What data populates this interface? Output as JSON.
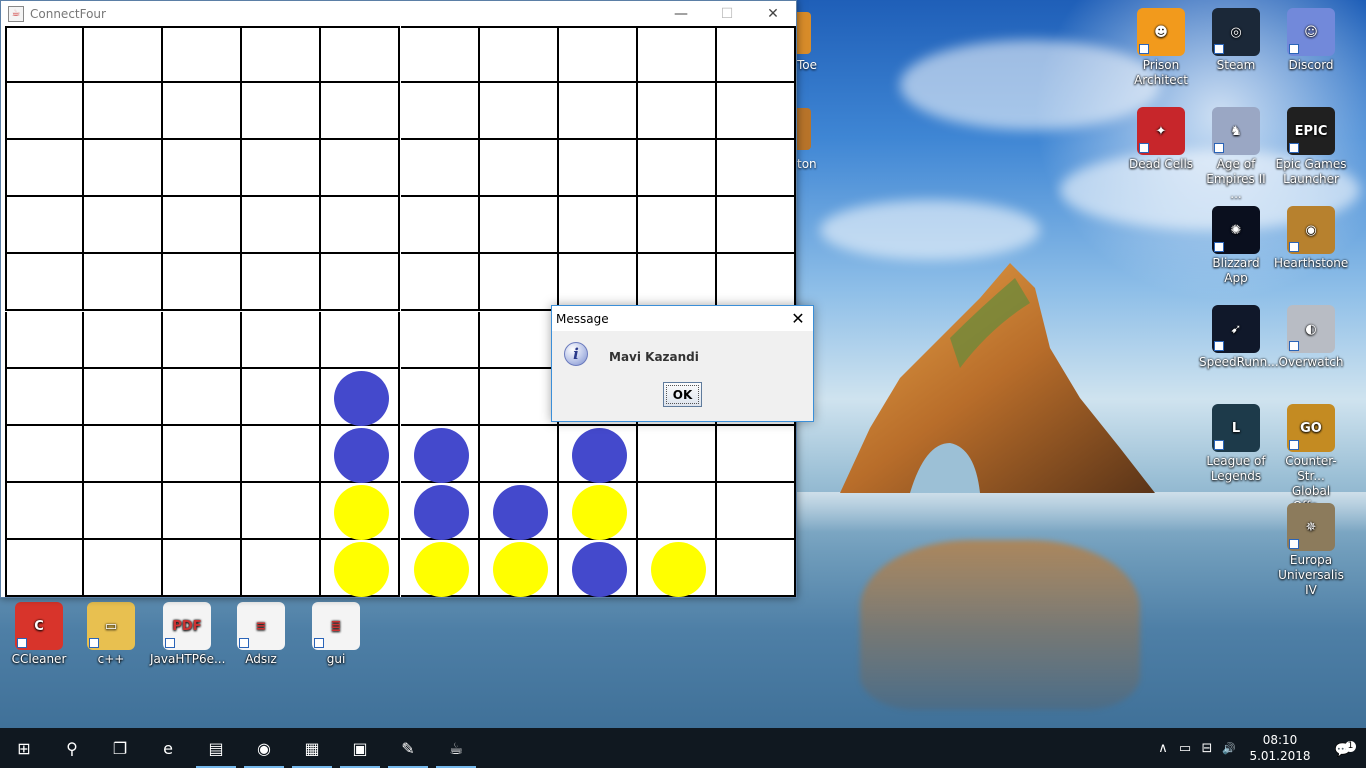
{
  "window": {
    "title": "ConnectFour",
    "minimize": "—",
    "maximize": "☐",
    "close": "✕"
  },
  "board": {
    "rows": 10,
    "cols": 10,
    "colors": {
      "blue": "#4449cc",
      "yellow": "#ffff00",
      "grid": "#000000"
    },
    "discs": [
      {
        "row": 6,
        "col": 4,
        "color": "blue"
      },
      {
        "row": 7,
        "col": 4,
        "color": "blue"
      },
      {
        "row": 7,
        "col": 5,
        "color": "blue"
      },
      {
        "row": 7,
        "col": 7,
        "color": "blue"
      },
      {
        "row": 8,
        "col": 4,
        "color": "yellow"
      },
      {
        "row": 8,
        "col": 5,
        "color": "blue"
      },
      {
        "row": 8,
        "col": 6,
        "color": "blue"
      },
      {
        "row": 8,
        "col": 7,
        "color": "yellow"
      },
      {
        "row": 9,
        "col": 4,
        "color": "yellow"
      },
      {
        "row": 9,
        "col": 5,
        "color": "yellow"
      },
      {
        "row": 9,
        "col": 6,
        "color": "yellow"
      },
      {
        "row": 9,
        "col": 7,
        "color": "blue"
      },
      {
        "row": 9,
        "col": 8,
        "color": "yellow"
      }
    ]
  },
  "dialog": {
    "title": "Message",
    "message": "Mavi Kazandi",
    "ok": "OK",
    "close": "✕",
    "icon": "i"
  },
  "desktop_partial": {
    "toe": "Toe",
    "ton": "ton"
  },
  "desktop_icons": [
    {
      "name": "Prison Architect",
      "label": "Prison\nArchitect",
      "glyph": "☻",
      "bg": "#f29a1c"
    },
    {
      "name": "Steam",
      "label": "Steam",
      "glyph": "◎",
      "bg": "#1b2838"
    },
    {
      "name": "Discord",
      "label": "Discord",
      "glyph": "☺",
      "bg": "#7289da"
    },
    {
      "name": "Dead Cells",
      "label": "Dead Cells",
      "glyph": "✦",
      "bg": "#c7262b"
    },
    {
      "name": "Age of Empires II",
      "label": "Age of\nEmpires II ...",
      "glyph": "♞",
      "bg": "#9aa7c4"
    },
    {
      "name": "Epic Games Launcher",
      "label": "Epic Games\nLauncher",
      "glyph": "EPIC",
      "bg": "#202020"
    },
    {
      "name": "Blizzard App",
      "label": "Blizzard App",
      "glyph": "✺",
      "bg": "#0a0f1e"
    },
    {
      "name": "Hearthstone",
      "label": "Hearthstone",
      "glyph": "◉",
      "bg": "#b7812e"
    },
    {
      "name": "SpeedRunners",
      "label": "SpeedRunn...",
      "glyph": "➹",
      "bg": "#10182a"
    },
    {
      "name": "Overwatch",
      "label": "Overwatch",
      "glyph": "◐",
      "bg": "#b8bcc4"
    },
    {
      "name": "League of Legends",
      "label": "League of\nLegends",
      "glyph": "L",
      "bg": "#1d3a4a"
    },
    {
      "name": "Counter-Strike Global Offensive",
      "label": "Counter-Str...\nGlobal Offe...",
      "glyph": "GO",
      "bg": "#c48b22"
    },
    {
      "name": "Europa Universalis IV",
      "label": "Europa\nUniversalis IV",
      "glyph": "✵",
      "bg": "#8c7b5c"
    },
    {
      "name": "CCleaner",
      "label": "CCleaner",
      "glyph": "C",
      "bg": "#d8342b"
    },
    {
      "name": "c++",
      "label": "c++",
      "glyph": "▭",
      "bg": "#e8c050"
    },
    {
      "name": "JavaHTP6e",
      "label": "JavaHTP6e...",
      "glyph": "PDF",
      "bg": "#f4f4f4"
    },
    {
      "name": "Adsiz",
      "label": "Adsız",
      "glyph": "≡",
      "bg": "#f4f4f4"
    },
    {
      "name": "gui",
      "label": "gui",
      "glyph": "≣",
      "bg": "#f4f4f4"
    }
  ],
  "taskbar": {
    "items": [
      {
        "name": "start-button",
        "glyph": "⊞"
      },
      {
        "name": "search-button",
        "glyph": "⚲"
      },
      {
        "name": "task-view-button",
        "glyph": "❐"
      },
      {
        "name": "edge-button",
        "glyph": "e"
      },
      {
        "name": "file-explorer-button",
        "glyph": "▤"
      },
      {
        "name": "chrome-button",
        "glyph": "◉"
      },
      {
        "name": "paint-button",
        "glyph": "▦"
      },
      {
        "name": "virtualbox-button",
        "glyph": "▣"
      },
      {
        "name": "paint-palette-button",
        "glyph": "✎"
      },
      {
        "name": "java-button",
        "glyph": "☕"
      }
    ],
    "tray": {
      "chevron": "∧",
      "battery": "▭",
      "network": "⊟",
      "volume": "🔊",
      "time": "08:10",
      "date": "5.01.2018",
      "notifications": "💬",
      "notif_count": "1"
    }
  }
}
